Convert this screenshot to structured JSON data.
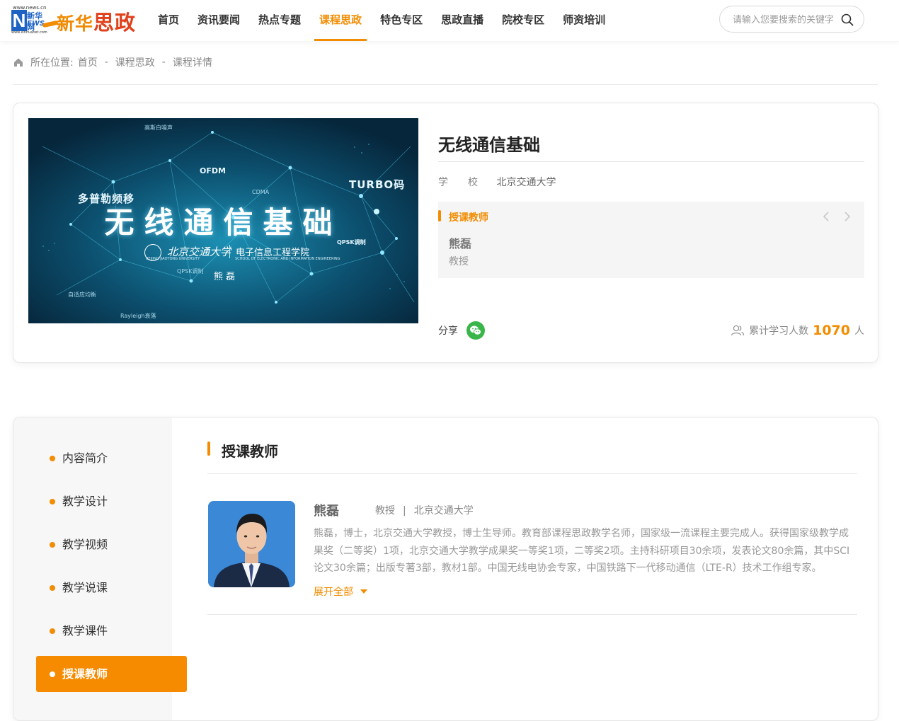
{
  "header": {
    "logo": {
      "url_top": "www.news.cn",
      "letter": "N",
      "cn": "新华网",
      "en": "EWS",
      "url_bottom": "www.xinhuanet.com",
      "brand_a": "新华",
      "brand_b": "思政"
    },
    "nav": [
      "首页",
      "资讯要闻",
      "热点专题",
      "课程思政",
      "特色专区",
      "思政直播",
      "院校专区",
      "师资培训"
    ],
    "active_nav": "课程思政",
    "search": {
      "placeholder": "请输入您要搜索的关键字",
      "icon": "search-icon"
    }
  },
  "breadcrumb": {
    "label": "所在位置:",
    "items": [
      "首页",
      "课程思政",
      "课程详情"
    ],
    "separator": "-"
  },
  "course": {
    "title": "无线通信基础",
    "school_label": "学校",
    "school": "北京交通大学",
    "cover": {
      "title": "无线通信基础",
      "tags": [
        "多普勒频移",
        "TURBO码",
        "OFDM",
        "QPSK调制",
        "CDMA",
        "高斯白噪声",
        "自适应均衡",
        "Rayleigh衰落",
        "QPSK调制"
      ],
      "school_cn": "北京交通大学",
      "school_en": "BEIJING JIAOTONG UNIVERSITY",
      "department": "电子信息工程学院",
      "department_en": "SCHOOL OF ELECTRONIC AND INFORMATION ENGINEERING",
      "teacher": "熊磊"
    },
    "teacher_box": {
      "title": "授课教师",
      "name": "熊磊",
      "rank": "教授"
    },
    "share_label": "分享",
    "learners_label": "累计学习人数",
    "learners_count": "1070",
    "learners_unit": "人"
  },
  "sidebar": {
    "items": [
      "内容简介",
      "教学设计",
      "教学视频",
      "教学说课",
      "教学课件",
      "授课教师"
    ],
    "active": "授课教师"
  },
  "teacher_section": {
    "title": "授课教师",
    "name": "熊磊",
    "rank": "教授",
    "school": "北京交通大学",
    "divider": "|",
    "bio": "熊磊，博士，北京交通大学教授，博士生导师。教育部课程思政教学名师，国家级一流课程主要完成人。获得国家级教学成果奖（二等奖）1项，北京交通大学教学成果奖一等奖1项，二等奖2项。主持科研项目30余项，发表论文80余篇，其中SCI论文30余篇；出版专著3部，教材1部。中国无线电协会专家，中国铁路下一代移动通信（LTE-R）技术工作组专家。",
    "expand_label": "展开全部"
  },
  "colors": {
    "accent": "#f28c00",
    "active_side_bg": "#f78b00",
    "wechat": "#39b54a"
  }
}
